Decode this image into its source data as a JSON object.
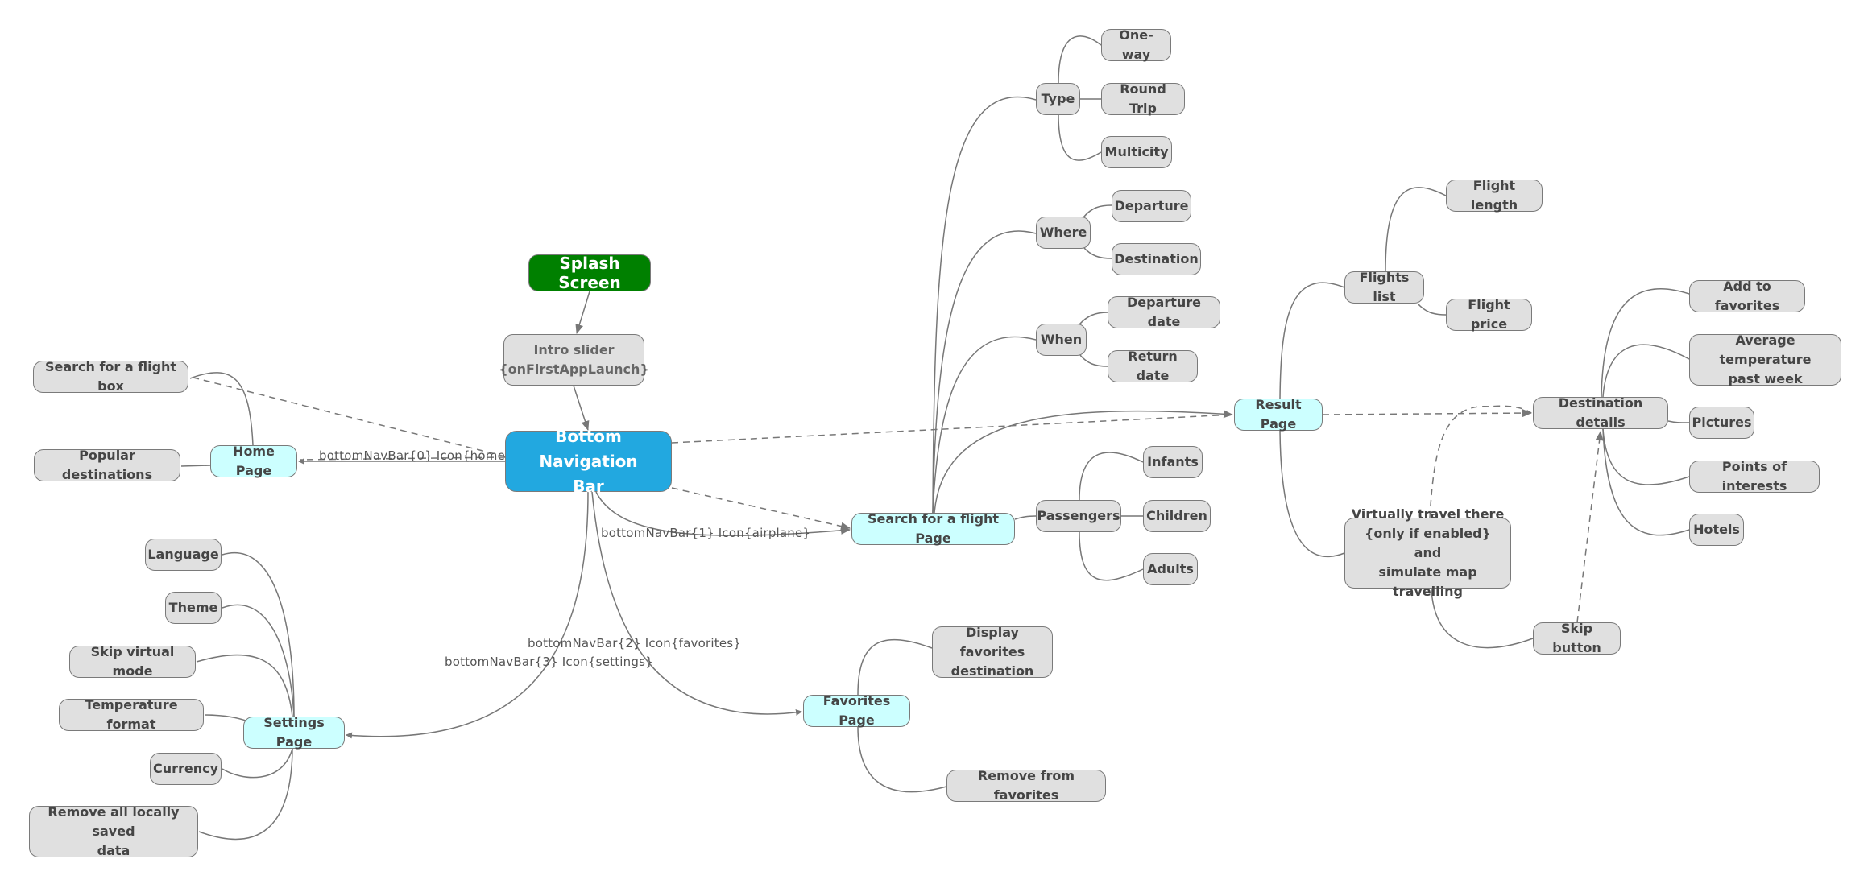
{
  "diagram": {
    "nodes": {
      "splash": "Splash Screen",
      "intro": "Intro slider\n{onFirstAppLaunch}",
      "bottom_nav": "Bottom Navigation\nBar",
      "home_page": "Home Page",
      "search_box": "Search for a flight box",
      "popular_destinations": "Popular destinations",
      "settings_page": "Settings Page",
      "language": "Language",
      "theme": "Theme",
      "skip_virtual": "Skip virtual mode",
      "temp_format": "Temperature format",
      "currency": "Currency",
      "remove_data": "Remove all locally saved\ndata",
      "favorites_page": "Favorites Page",
      "display_favorites": "Display favorites\ndestination",
      "remove_favorites": "Remove from favorites",
      "search_page": "Search for a flight Page",
      "type": "Type",
      "one_way": "One-way",
      "round_trip": "Round Trip",
      "multicity": "Multicity",
      "where": "Where",
      "departure": "Departure",
      "destination": "Destination",
      "when": "When",
      "departure_date": "Departure date",
      "return_date": "Return date",
      "passengers": "Passengers",
      "infants": "Infants",
      "children": "Children",
      "adults": "Adults",
      "result_page": "Result Page",
      "flights_list": "Flights list",
      "flight_length": "Flight length",
      "flight_price": "Flight price",
      "virtual_travel": "Virtually travel there\n{only if enabled} and\nsimulate map travelling",
      "skip_button": "Skip button",
      "destination_details": "Destination details",
      "add_favorites": "Add to favorites",
      "avg_temp": "Average temperature\npast week",
      "pictures": "Pictures",
      "points_of_interest": "Points of interests",
      "hotels": "Hotels"
    },
    "edge_labels": {
      "nav0": "bottomNavBar{0} Icon{home}",
      "nav1": "bottomNavBar{1} Icon{airplane}",
      "nav2": "bottomNavBar{2} Icon{favorites}",
      "nav3": "bottomNavBar{3} Icon{settings}"
    },
    "colors": {
      "page_node": "#ccffff",
      "feature_node": "#e0e0e0",
      "root_node": "#22a8e0",
      "splash_node": "#008000",
      "edge": "#777777"
    }
  }
}
